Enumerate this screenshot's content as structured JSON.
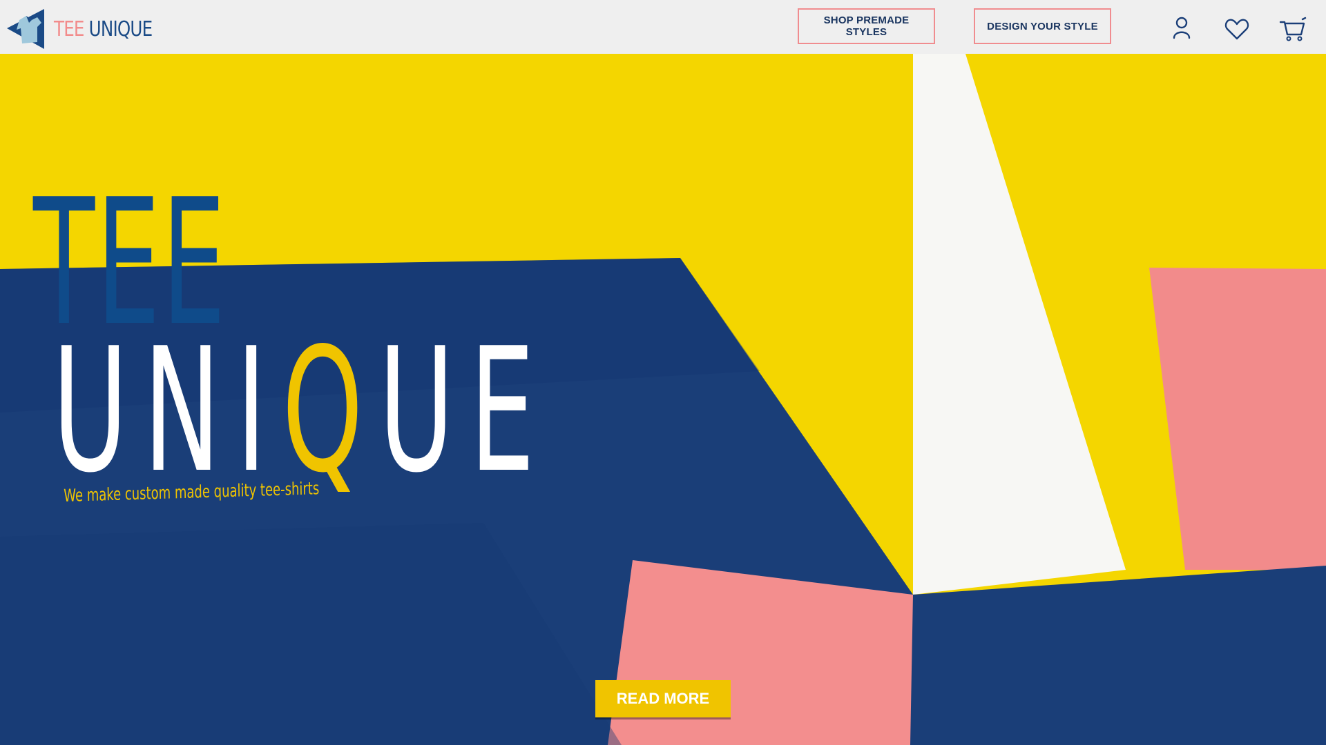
{
  "brand": {
    "logo_part1": "TEE",
    "logo_part2": "UNIQUE",
    "logo_icon": "tee-shirt-triangle-logo"
  },
  "nav": {
    "shop_label": "SHOP PREMADE STYLES",
    "design_label": "DESIGN YOUR STYLE",
    "icons": [
      "user-icon",
      "heart-icon",
      "cart-icon"
    ]
  },
  "hero": {
    "title_line1": "TEE",
    "title_line2_pre": "UNI",
    "title_line2_q": "Q",
    "title_line2_post": "UE",
    "tagline": "We make custom made quality tee-shirts",
    "cta_label": "READ MORE"
  },
  "colors": {
    "yellow": "#f4d600",
    "navy": "#1a3e78",
    "pink": "#f28b8b",
    "white": "#ffffff",
    "accent_border": "#f08c8f",
    "title_blue": "#0f4b8a",
    "gold": "#f0c400"
  }
}
